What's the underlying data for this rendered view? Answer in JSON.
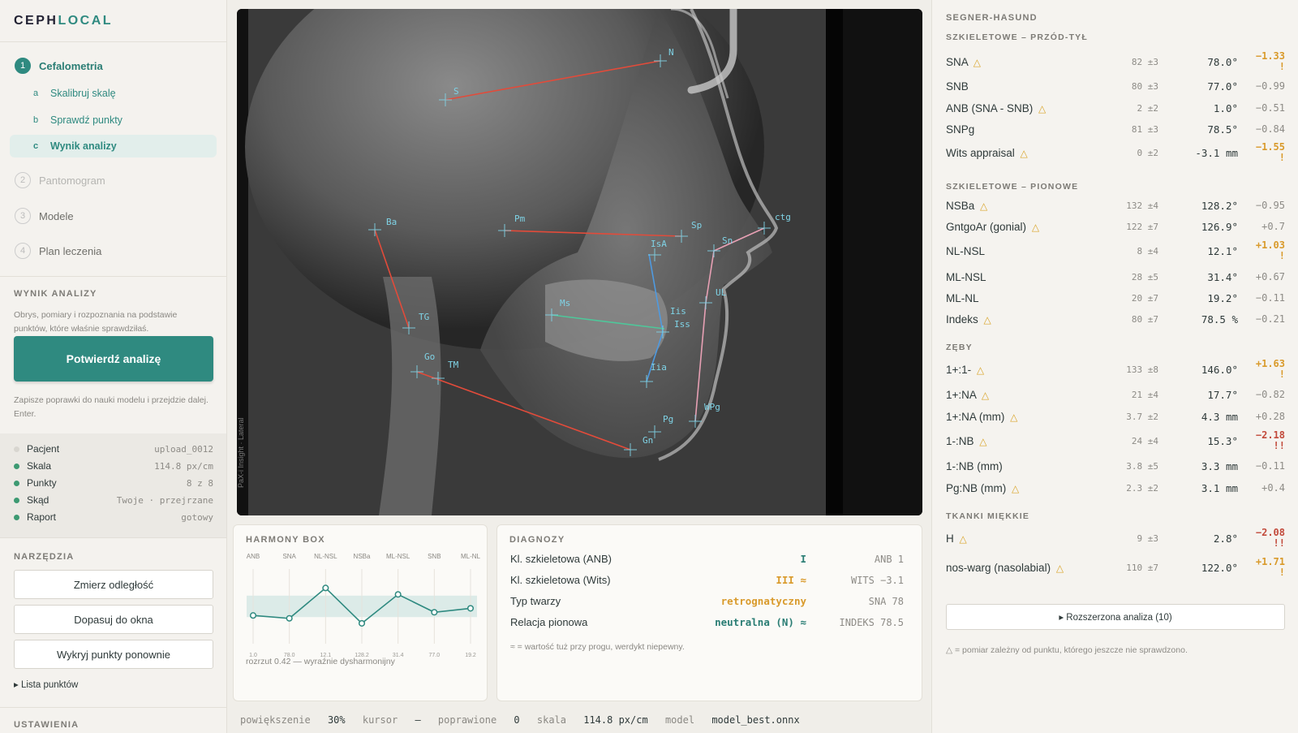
{
  "app": {
    "logo_a": "CEPH",
    "logo_b": "LOCAL"
  },
  "steps": [
    {
      "num": "1",
      "label": "Cefalometria"
    },
    {
      "num": "2",
      "label": "Pantomogram"
    },
    {
      "num": "3",
      "label": "Modele"
    },
    {
      "num": "4",
      "label": "Plan leczenia"
    }
  ],
  "substeps": [
    {
      "letter": "a",
      "label": "Skalibruj skalę"
    },
    {
      "letter": "b",
      "label": "Sprawdź punkty"
    },
    {
      "letter": "c",
      "label": "Wynik analizy"
    }
  ],
  "result": {
    "heading": "WYNIK ANALIZY",
    "desc": "Obrys, pomiary i rozpoznania na podstawie punktów, które właśnie sprawdziłaś.",
    "confirm": "Potwierdź analizę",
    "note": "Zapisze poprawki do nauki modelu i przejdzie dalej. Enter."
  },
  "status_list": [
    {
      "k": "Pacjent",
      "v": "upload_0012",
      "on": false
    },
    {
      "k": "Skala",
      "v": "114.8 px/cm",
      "on": true
    },
    {
      "k": "Punkty",
      "v": "8 z 8",
      "on": true
    },
    {
      "k": "Skąd",
      "v": "Twoje · przejrzane",
      "on": true
    },
    {
      "k": "Raport",
      "v": "gotowy",
      "on": true
    }
  ],
  "tools": {
    "heading": "NARZĘDZIA",
    "measure": "Zmierz odległość",
    "fit": "Dopasuj do okna",
    "redetect": "Wykryj punkty ponownie",
    "points_list": "▸ Lista punktów"
  },
  "settings": {
    "heading": "USTAWIENIA"
  },
  "xray": {
    "watermark": "PaX-i Insight · Lateral",
    "landmarks": [
      "N",
      "S",
      "Ba",
      "Pm",
      "Sp",
      "ctg",
      "IsA",
      "Sn",
      "UL",
      "Iis",
      "Iss",
      "Ms",
      "TG",
      "Go",
      "TM",
      "Iia",
      "Pg",
      "WPg",
      "Gn"
    ]
  },
  "harmony": {
    "title": "HARMONY BOX",
    "labels": [
      "ANB",
      "SNA",
      "NL-NSL",
      "NSBa",
      "ML-NSL",
      "SNB",
      "ML-NL"
    ],
    "values": [
      "1.0",
      "78.0",
      "12.1",
      "128.2",
      "31.4",
      "77.0",
      "19.2"
    ],
    "sd": [
      -0.51,
      -0.67,
      1.03,
      -0.95,
      0.67,
      -0.33,
      -0.11
    ],
    "spread": "rozrzut 0.42 — wyraźnie dysharmonijny"
  },
  "diagnoses": {
    "title": "DIAGNOZY",
    "rows": [
      {
        "name": "Kl. szkieletowa (ANB)",
        "value": "I",
        "ref": "ANB 1",
        "color": "#2a7d74"
      },
      {
        "name": "Kl. szkieletowa (Wits)",
        "value": "III ≈",
        "ref": "WITS −3.1",
        "color": "#d99a2b"
      },
      {
        "name": "Typ twarzy",
        "value": "retrognatyczny",
        "ref": "SNA 78",
        "color": "#d99a2b"
      },
      {
        "name": "Relacja pionowa",
        "value": "neutralna (N) ≈",
        "ref": "INDEKS 78.5",
        "color": "#2a7d74"
      }
    ],
    "note": "≈ = wartość tuż przy progu, werdykt niepewny."
  },
  "statusbar": {
    "zoom_k": "powiększenie",
    "zoom_v": "30%",
    "cursor_k": "kursor",
    "cursor_v": "—",
    "fixed_k": "poprawione",
    "fixed_v": "0",
    "scale_k": "skala",
    "scale_v": "114.8 px/cm",
    "model_k": "model",
    "model_v": "model_best.onnx"
  },
  "analysis": {
    "title": "SEGNER-HASUND",
    "sections": [
      {
        "title": "SZKIELETOWE – PRZÓD-TYŁ",
        "rows": [
          {
            "name": "SNA",
            "tri": true,
            "norm": "82 ±3",
            "value": "78.0°",
            "sd": "−1.33",
            "flag": "!",
            "level": "warn"
          },
          {
            "name": "SNB",
            "tri": false,
            "norm": "80 ±3",
            "value": "77.0°",
            "sd": "−0.99",
            "flag": "",
            "level": ""
          },
          {
            "name": "ANB (SNA - SNB)",
            "tri": true,
            "norm": "2 ±2",
            "value": "1.0°",
            "sd": "−0.51",
            "flag": "",
            "level": ""
          },
          {
            "name": "SNPg",
            "tri": false,
            "norm": "81 ±3",
            "value": "78.5°",
            "sd": "−0.84",
            "flag": "",
            "level": ""
          },
          {
            "name": "Wits appraisal",
            "tri": true,
            "norm": "0 ±2",
            "value": "-3.1 mm",
            "sd": "−1.55",
            "flag": "!",
            "level": "warn"
          }
        ]
      },
      {
        "title": "SZKIELETOWE – PIONOWE",
        "rows": [
          {
            "name": "NSBa",
            "tri": true,
            "norm": "132 ±4",
            "value": "128.2°",
            "sd": "−0.95",
            "flag": "",
            "level": ""
          },
          {
            "name": "GntgoAr (gonial)",
            "tri": true,
            "norm": "122 ±7",
            "value": "126.9°",
            "sd": "+0.7",
            "flag": "",
            "level": ""
          },
          {
            "name": "NL-NSL",
            "tri": false,
            "norm": "8 ±4",
            "value": "12.1°",
            "sd": "+1.03",
            "flag": "!",
            "level": "warn"
          },
          {
            "name": "ML-NSL",
            "tri": false,
            "norm": "28 ±5",
            "value": "31.4°",
            "sd": "+0.67",
            "flag": "",
            "level": ""
          },
          {
            "name": "ML-NL",
            "tri": false,
            "norm": "20 ±7",
            "value": "19.2°",
            "sd": "−0.11",
            "flag": "",
            "level": ""
          },
          {
            "name": "Indeks",
            "tri": true,
            "norm": "80 ±7",
            "value": "78.5 %",
            "sd": "−0.21",
            "flag": "",
            "level": ""
          }
        ]
      },
      {
        "title": "ZĘBY",
        "rows": [
          {
            "name": "1+:1-",
            "tri": true,
            "norm": "133 ±8",
            "value": "146.0°",
            "sd": "+1.63",
            "flag": "!",
            "level": "warn"
          },
          {
            "name": "1+:NA",
            "tri": true,
            "norm": "21 ±4",
            "value": "17.7°",
            "sd": "−0.82",
            "flag": "",
            "level": ""
          },
          {
            "name": "1+:NA (mm)",
            "tri": true,
            "norm": "3.7 ±2",
            "value": "4.3 mm",
            "sd": "+0.28",
            "flag": "",
            "level": ""
          },
          {
            "name": "1-:NB",
            "tri": true,
            "norm": "24 ±4",
            "value": "15.3°",
            "sd": "−2.18",
            "flag": "!!",
            "level": "bad"
          },
          {
            "name": "1-:NB (mm)",
            "tri": false,
            "norm": "3.8 ±5",
            "value": "3.3 mm",
            "sd": "−0.11",
            "flag": "",
            "level": ""
          },
          {
            "name": "Pg:NB (mm)",
            "tri": true,
            "norm": "2.3 ±2",
            "value": "3.1 mm",
            "sd": "+0.4",
            "flag": "",
            "level": ""
          }
        ]
      },
      {
        "title": "TKANKI MIĘKKIE",
        "rows": [
          {
            "name": "H",
            "tri": true,
            "norm": "9 ±3",
            "value": "2.8°",
            "sd": "−2.08",
            "flag": "!!",
            "level": "bad"
          },
          {
            "name": "nos-warg (nasolabial)",
            "tri": true,
            "norm": "110 ±7",
            "value": "122.0°",
            "sd": "+1.71",
            "flag": "!",
            "level": "warn"
          }
        ]
      }
    ],
    "extended": "▸ Rozszerzona analiza (10)",
    "footnote": "△ = pomiar zależny od punktu, którego jeszcze nie sprawdzono.",
    "tri_glyph": "△"
  }
}
